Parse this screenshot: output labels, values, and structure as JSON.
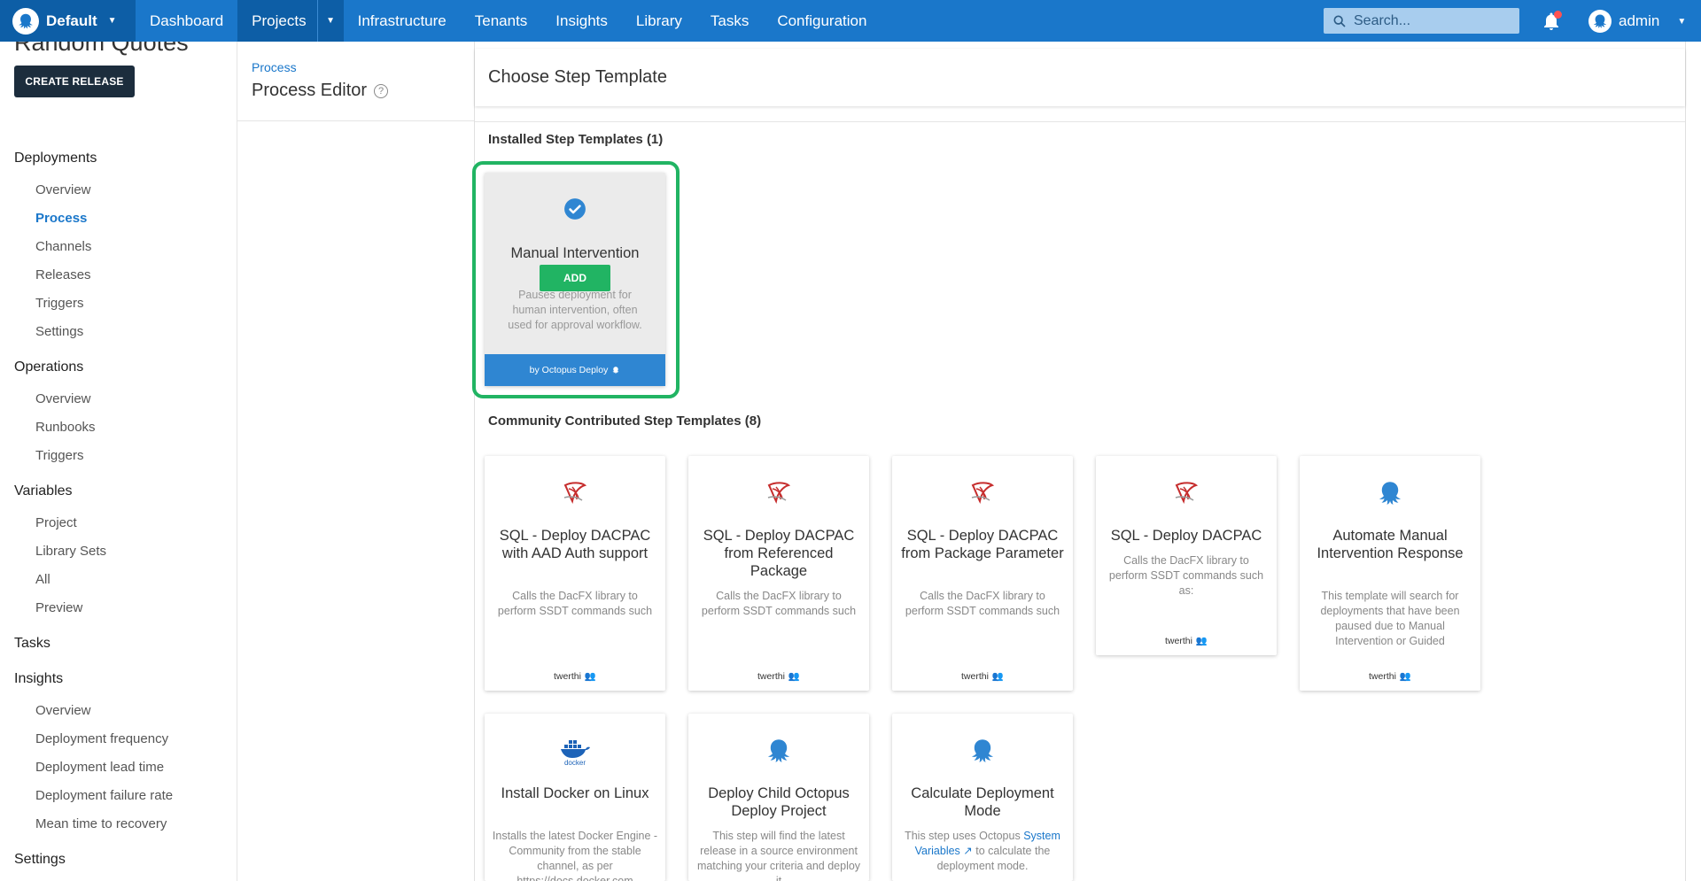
{
  "topnav": {
    "space": "Default",
    "links": [
      "Dashboard",
      "Projects",
      "Infrastructure",
      "Tenants",
      "Insights",
      "Library",
      "Tasks",
      "Configuration"
    ],
    "search_placeholder": "Search...",
    "user": "admin"
  },
  "sidebar": {
    "project_title": "Random Quotes",
    "create_release": "CREATE RELEASE",
    "headings": {
      "deployments": "Deployments",
      "operations": "Operations",
      "variables": "Variables",
      "tasks": "Tasks",
      "insights": "Insights",
      "settings": "Settings"
    },
    "deployments": [
      "Overview",
      "Process",
      "Channels",
      "Releases",
      "Triggers",
      "Settings"
    ],
    "operations": [
      "Overview",
      "Runbooks",
      "Triggers"
    ],
    "variables": [
      "Project",
      "Library Sets",
      "All",
      "Preview"
    ],
    "insights": [
      "Overview",
      "Deployment frequency",
      "Deployment lead time",
      "Deployment failure rate",
      "Mean time to recovery"
    ]
  },
  "process": {
    "breadcrumb": "Process",
    "title": "Process Editor"
  },
  "main": {
    "title": "Choose Step Template",
    "installed_heading": "Installed Step Templates (1)",
    "community_heading": "Community Contributed Step Templates (8)",
    "installed": {
      "name": "Manual Intervention",
      "add_label": "ADD",
      "description": "Pauses deployment for human intervention, often used for approval workflow.",
      "footer": "by Octopus Deploy"
    },
    "community": [
      {
        "name": "SQL - Deploy DACPAC with AAD Auth support",
        "description": "Calls the DacFX library to perform SSDT commands such as:",
        "author": "twerthi",
        "icon": "sql-server-icon"
      },
      {
        "name": "SQL - Deploy DACPAC from Referenced Package",
        "description": "Calls the DacFX library to perform SSDT commands such as:",
        "author": "twerthi",
        "icon": "sql-server-icon"
      },
      {
        "name": "SQL - Deploy DACPAC from Package Parameter",
        "description": "Calls the DacFX library to perform SSDT commands such as:",
        "author": "twerthi",
        "icon": "sql-server-icon"
      },
      {
        "name": "SQL - Deploy DACPAC",
        "description": "Calls the DacFX library to perform SSDT commands such as:",
        "author": "twerthi",
        "icon": "sql-server-icon"
      },
      {
        "name": "Automate Manual Intervention Response",
        "description": "This template will search for deployments that have been paused due to Manual Intervention or Guided",
        "author": "twerthi",
        "icon": "octopus-icon"
      },
      {
        "name": "Install Docker on Linux",
        "description": "Installs the latest Docker Engine - Community from the stable channel, as per https://docs.docker.com",
        "author": "",
        "icon": "docker-icon"
      },
      {
        "name": "Deploy Child Octopus Deploy Project",
        "description": "This step will find the latest release in a source environment matching your criteria and deploy it",
        "author": "",
        "icon": "octopus-icon"
      },
      {
        "name": "Calculate Deployment Mode",
        "description_pre": "This step uses Octopus",
        "description_link": "System Variables",
        "description_post": "to calculate the deployment mode.",
        "author": "",
        "icon": "octopus-icon"
      }
    ]
  },
  "colors": {
    "nav_blue": "#1a77ca",
    "nav_dark": "#0d5ea6",
    "selected_green": "#21b463",
    "sql_red": "#c62d2d"
  }
}
